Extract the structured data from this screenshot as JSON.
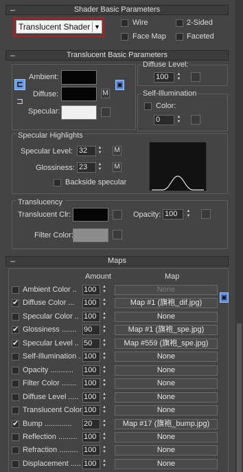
{
  "shader_basic": {
    "title": "Shader Basic Parameters",
    "shader_select": "Translucent Shader",
    "options": [
      {
        "label": "Wire",
        "checked": false
      },
      {
        "label": "2-Sided",
        "checked": false
      },
      {
        "label": "Face Map",
        "checked": false
      },
      {
        "label": "Faceted",
        "checked": false
      }
    ]
  },
  "translucent_basic": {
    "title": "Translucent Basic Parameters",
    "ambient_label": "Ambient:",
    "diffuse_label": "Diffuse:",
    "specular_label": "Specular:",
    "m_label": "M",
    "colors": {
      "ambient": "#050505",
      "diffuse": "#050505",
      "specular": "#f0f0f0"
    },
    "diffuse_level": {
      "label": "Diffuse Level:",
      "value": "100"
    },
    "self_illum": {
      "label": "Self-Illumination",
      "color_label": "Color:",
      "value": "0"
    },
    "specular_highlights": {
      "label": "Specular Highlights",
      "level_label": "Specular Level:",
      "level_value": "32",
      "gloss_label": "Glossiness:",
      "gloss_value": "23",
      "backside_label": "Backside specular"
    },
    "translucency": {
      "label": "Translucency",
      "clr_label": "Translucent Clr:",
      "opacity_label": "Opacity:",
      "opacity_value": "100",
      "filter_label": "Filter Color:",
      "colors": {
        "translucent": "#050505",
        "filter": "#8c8c8c"
      }
    }
  },
  "maps": {
    "title": "Maps",
    "col_amount": "Amount",
    "col_map": "Map",
    "rows": [
      {
        "label": "Ambient Color ..",
        "checked": false,
        "amount": "100",
        "map": "None",
        "disabled": true
      },
      {
        "label": "Diffuse Color ...",
        "checked": true,
        "amount": "100",
        "map": "Map #1 (旗袍_dif.jpg)",
        "disabled": false
      },
      {
        "label": "Specular Color ..",
        "checked": false,
        "amount": "100",
        "map": "None",
        "disabled": false
      },
      {
        "label": "Glossiness .......",
        "checked": true,
        "amount": "90",
        "map": "Map #1 (旗袍_spe.jpg)",
        "disabled": false
      },
      {
        "label": "Specular Level ..",
        "checked": true,
        "amount": "50",
        "map": "Map #559 (旗袍_spe.jpg)",
        "disabled": false
      },
      {
        "label": "Self-Illumination .",
        "checked": false,
        "amount": "100",
        "map": "None",
        "disabled": false
      },
      {
        "label": "Opacity ...........",
        "checked": false,
        "amount": "100",
        "map": "None",
        "disabled": false
      },
      {
        "label": "Filter Color .......",
        "checked": false,
        "amount": "100",
        "map": "None",
        "disabled": false
      },
      {
        "label": "Diffuse Level .....",
        "checked": false,
        "amount": "100",
        "map": "None",
        "disabled": false
      },
      {
        "label": "Translucent Color",
        "checked": false,
        "amount": "100",
        "map": "None",
        "disabled": false
      },
      {
        "label": "Bump .............",
        "checked": true,
        "amount": "20",
        "map": "Map #17 (旗袍_bump.jpg)",
        "disabled": false
      },
      {
        "label": "Reflection .........",
        "checked": false,
        "amount": "100",
        "map": "None",
        "disabled": false
      },
      {
        "label": "Refraction .........",
        "checked": false,
        "amount": "100",
        "map": "None",
        "disabled": false
      },
      {
        "label": "Displacement .....",
        "checked": false,
        "amount": "100",
        "map": "None",
        "disabled": false
      }
    ]
  }
}
